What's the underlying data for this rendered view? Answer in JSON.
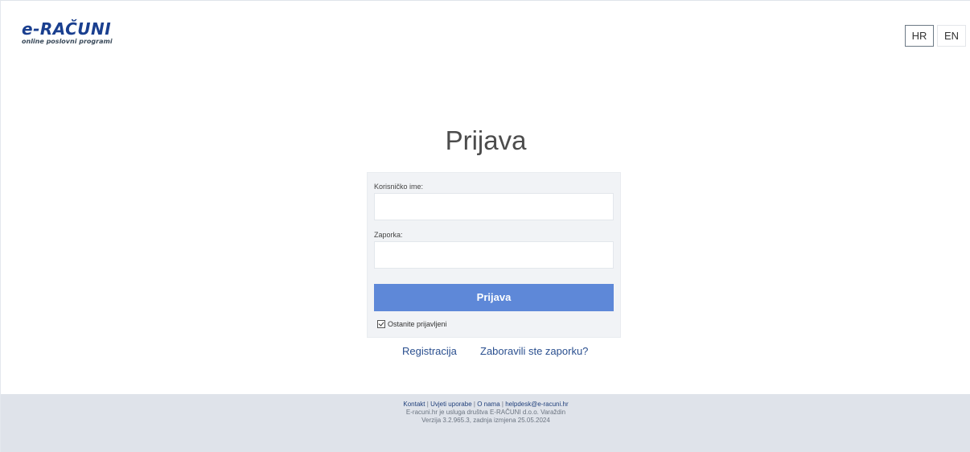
{
  "logo": {
    "main": "e-RAČUNI",
    "sub": "online poslovni programi"
  },
  "languages": {
    "hr": "HR",
    "en": "EN"
  },
  "title": "Prijava",
  "form": {
    "username_label": "Korisničko ime:",
    "username_value": "",
    "password_label": "Zaporka:",
    "password_value": "",
    "submit_label": "Prijava",
    "remember_label": "Ostanite prijavljeni",
    "remember_checked": true
  },
  "links": {
    "register": "Registracija",
    "forgot": "Zaboravili ste zaporku?"
  },
  "footer": {
    "contact": "Kontakt",
    "terms": "Uvjeti uporabe",
    "about": "O nama",
    "email": "helpdesk@e-racuni.hr",
    "separator": "|",
    "company_line": "E-racuni.hr je usluga društva E-RAČUNI d.o.o. Varaždin",
    "version_line": "Verzija 3.2.965.3, zadnja izmjena 25.05.2024"
  },
  "colors": {
    "accent": "#5e88d8",
    "logo": "#1a3f8f",
    "footer_bg": "#dfe3ea",
    "link": "#2a4f8f"
  }
}
